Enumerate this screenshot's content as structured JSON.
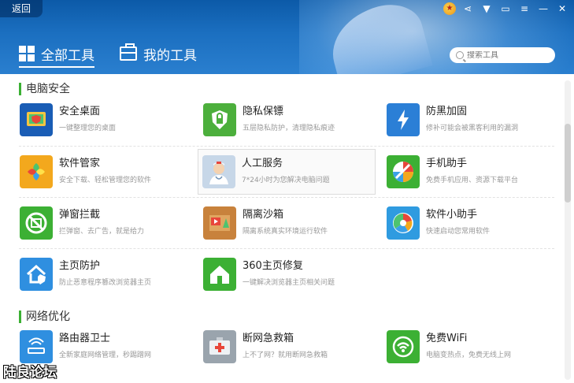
{
  "header": {
    "back_label": "返回",
    "tabs": [
      {
        "label": "全部工具",
        "icon": "grid-icon",
        "active": true
      },
      {
        "label": "我的工具",
        "icon": "toolbox-icon",
        "active": false
      }
    ],
    "search_placeholder": "搜索工具",
    "window_controls": [
      "medal-icon",
      "share-icon",
      "skin-icon",
      "message-icon",
      "menu-icon",
      "minimize-icon",
      "close-icon"
    ]
  },
  "sections": [
    {
      "title": "电脑安全",
      "tools": [
        {
          "name": "安全桌面",
          "desc": "一键整理您的桌面",
          "color": "#1a5db5"
        },
        {
          "name": "隐私保镖",
          "desc": "五层隐私防护，清理隐私痕迹",
          "color": "#4caf3c"
        },
        {
          "name": "防黑加固",
          "desc": "修补可能会被黑客利用的漏洞",
          "color": "#2b7fd6"
        },
        {
          "name": "软件管家",
          "desc": "安全下载、轻松管理您的软件",
          "color": "#f3a81d"
        },
        {
          "name": "人工服务",
          "desc": "7*24小时为您解决电脑问题",
          "color": "#c7d7e8"
        },
        {
          "name": "手机助手",
          "desc": "免费手机应用、资源下载平台",
          "color": "#3cb034"
        },
        {
          "name": "弹窗拦截",
          "desc": "拦弹窗、去广告，就是给力",
          "color": "#3cb034"
        },
        {
          "name": "隔离沙箱",
          "desc": "隔离系统真实环境运行软件",
          "color": "#c8823c"
        },
        {
          "name": "软件小助手",
          "desc": "快速启动您常用软件",
          "color": "#2f9be0"
        },
        {
          "name": "主页防护",
          "desc": "防止恶意程序篡改浏览器主页",
          "color": "#2f8fe0"
        },
        {
          "name": "360主页修复",
          "desc": "一键解决浏览器主页相关问题",
          "color": "#3cb034"
        }
      ]
    },
    {
      "title": "网络优化",
      "tools": [
        {
          "name": "路由器卫士",
          "desc": "全新家庭网络管理，秒踢蹭网",
          "color": "#2f8fe0"
        },
        {
          "name": "断网急救箱",
          "desc": "上不了网？就用断网急救箱",
          "color": "#9aa4ad"
        },
        {
          "name": "免费WiFi",
          "desc": "电脑变热点，免费无线上网",
          "color": "#3cb034"
        }
      ]
    }
  ],
  "watermark": "陆良论坛"
}
